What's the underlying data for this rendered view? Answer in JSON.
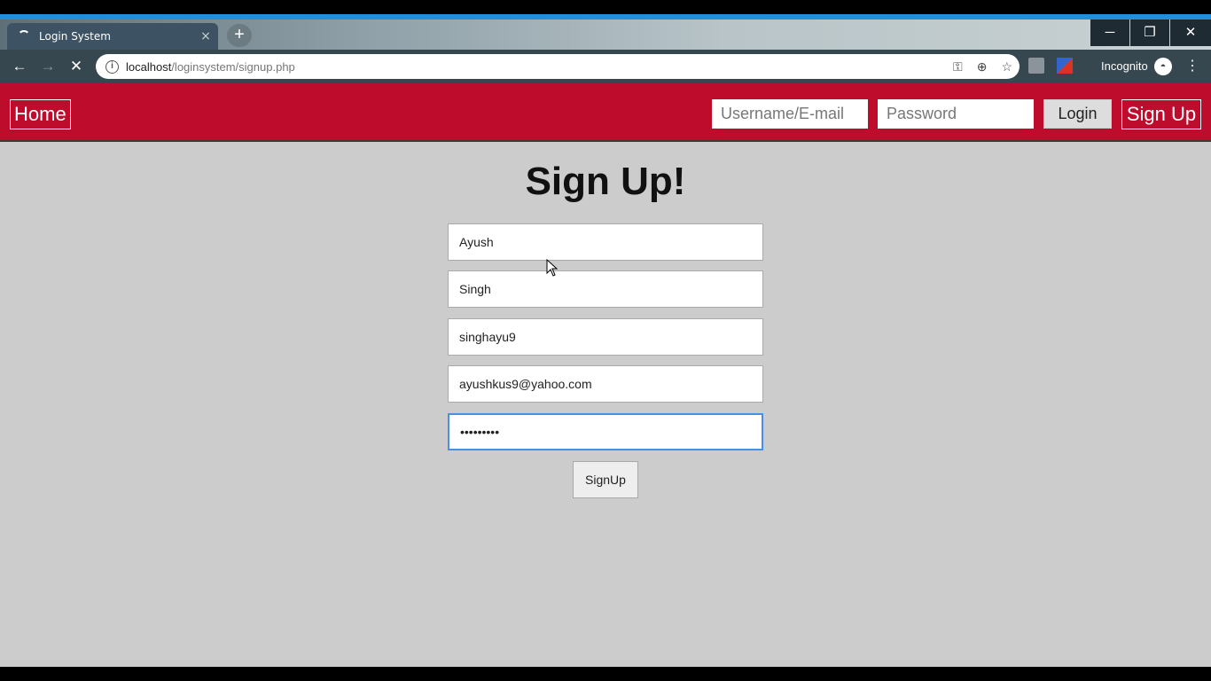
{
  "browser": {
    "tab_title": "Login System",
    "tab_close": "×",
    "new_tab": "+",
    "url_host": "localhost",
    "url_path": "/loginsystem/signup.php",
    "incognito_label": "Incognito",
    "window_controls": {
      "minimize": "─",
      "restore": "❐",
      "close": "✕"
    },
    "nav": {
      "back": "←",
      "forward": "→",
      "stop": "✕"
    },
    "accent_color": "#1f8fe0"
  },
  "header": {
    "home_label": "Home",
    "username_placeholder": "Username/E-mail",
    "password_placeholder": "Password",
    "login_label": "Login",
    "signup_label": "Sign Up",
    "bg_color": "#be0c2d"
  },
  "form": {
    "heading": "Sign Up!",
    "first_name": "Ayush",
    "last_name": "Singh",
    "username": "singhayu9",
    "email": "ayushkus9@yahoo.com",
    "password": "•••••••••",
    "submit_label": "SignUp"
  }
}
